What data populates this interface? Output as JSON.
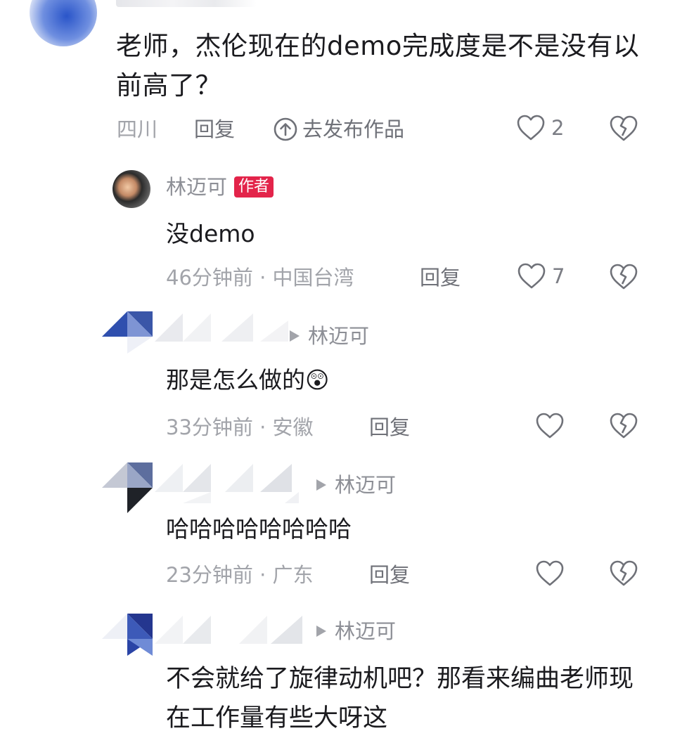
{
  "comment": {
    "text": "老师，杰伦现在的demo完成度是不是没有以前高了？",
    "location": "四川",
    "reply_label": "回复",
    "publish_label": "去发布作品",
    "likes": "2"
  },
  "replies": [
    {
      "author": "林迈可",
      "badge": "作者",
      "text": "没demo",
      "time_location": "46分钟前 · 中国台湾",
      "reply_label": "回复",
      "likes": "7"
    },
    {
      "reply_to": "林迈可",
      "text": "那是怎么做的😲",
      "time_location": "33分钟前 · 安徽",
      "reply_label": "回复",
      "likes": ""
    },
    {
      "reply_to": "林迈可",
      "text": "哈哈哈哈哈哈哈哈",
      "time_location": "23分钟前 · 广东",
      "reply_label": "回复",
      "likes": ""
    },
    {
      "reply_to": "林迈可",
      "text": "不会就给了旋律动机吧？那看来编曲老师现在工作量有些大呀这"
    }
  ],
  "icons": {
    "heart": "heart-icon",
    "dislike": "broken-heart-icon",
    "upload": "upload-circle-icon",
    "arrow": "triangle-right-icon"
  },
  "colors": {
    "badge": "#e3244a",
    "meta": "#a2a4aa",
    "text": "#1b1b1f"
  }
}
